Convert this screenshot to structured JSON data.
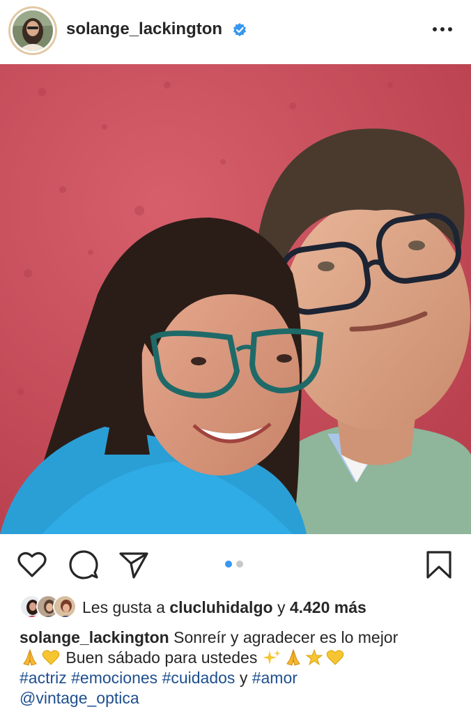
{
  "post": {
    "username": "solange_lackington",
    "verified": true,
    "carousel": {
      "count": 2,
      "active_index": 0
    },
    "likes": {
      "prefix": "Les gusta a",
      "user": "clucluhidalgo",
      "conjunction": "y",
      "count": "4.420 más"
    },
    "caption": {
      "username": "solange_lackington",
      "line1": "Sonreír y agradecer es lo mejor",
      "line2_text": "Buen sábado para ustedes",
      "hashtags": [
        "#actriz",
        "#emociones",
        "#cuidados"
      ],
      "and_word": "y",
      "last_hashtag": "#amor",
      "mention": "@vintage_optica"
    }
  },
  "icons": {
    "like": "heart-icon",
    "comment": "comment-icon",
    "share": "send-icon",
    "save": "bookmark-icon",
    "more": "more-options-icon",
    "verified": "verified-badge-icon"
  },
  "colors": {
    "text": "#262626",
    "link": "#1e4f8f",
    "verified": "#3897f0",
    "active_dot": "#3897f0",
    "wall": "#c8505c",
    "sweater_left": "#2a9fd6",
    "sweater_right": "#8fb59a"
  }
}
